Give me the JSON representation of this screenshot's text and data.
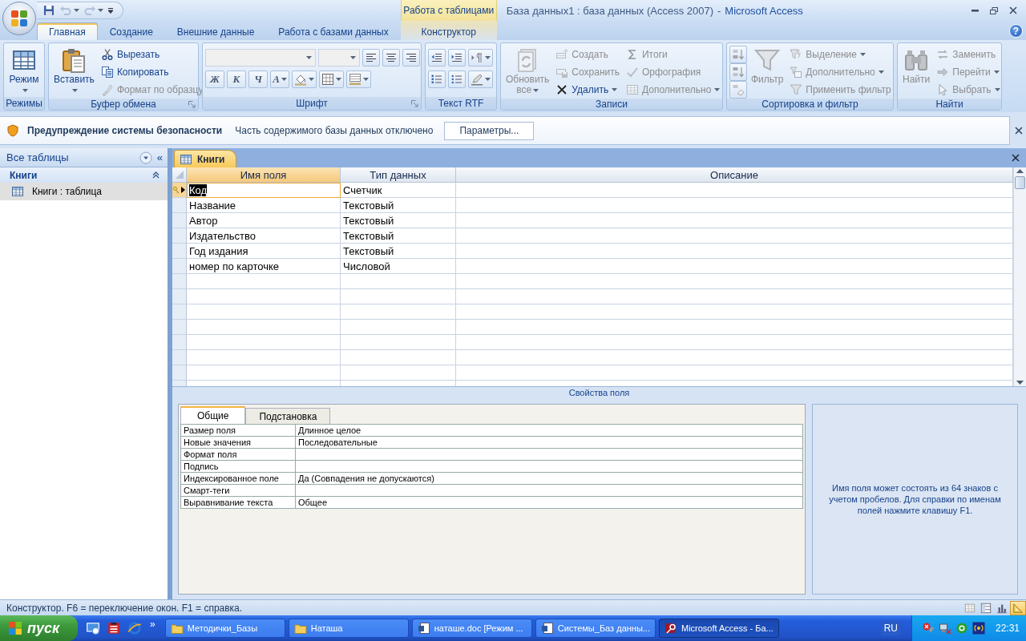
{
  "title_bar": {
    "context_group": "Работа с таблицами",
    "document_title": "База данных1 : база данных (Access 2007)",
    "separator": "-",
    "app_name": "Microsoft Access"
  },
  "quick_access": [
    {
      "kind": "button",
      "disabled": false
    },
    {
      "kind": "button",
      "disabled": true,
      "dropdown": true
    },
    {
      "kind": "button",
      "disabled": true,
      "dropdown": true
    },
    {
      "kind": "menu"
    }
  ],
  "ribbon_tabs": [
    {
      "label": "Главная",
      "selected": true,
      "contextual": false
    },
    {
      "label": "Создание",
      "selected": false,
      "contextual": false
    },
    {
      "label": "Внешние данные",
      "selected": false,
      "contextual": false
    },
    {
      "label": "Работа с базами данных",
      "selected": false,
      "contextual": false
    },
    {
      "label": "Конструктор",
      "selected": false,
      "contextual": true
    }
  ],
  "help_button": "?",
  "ribbon_groups": [
    {
      "title": "Режимы",
      "launcher": false,
      "items": [
        {
          "kind": "large",
          "label": "Режим",
          "dropdown": true,
          "disabled": false
        }
      ]
    },
    {
      "title": "Буфер обмена",
      "launcher": true,
      "items": [
        {
          "kind": "large",
          "label": "Вставить",
          "dropdown": true,
          "disabled": false
        },
        {
          "kind": "small",
          "label": "Вырезать",
          "disabled": false
        },
        {
          "kind": "small",
          "label": "Копировать",
          "disabled": false
        },
        {
          "kind": "small",
          "label": "Формат по образцу",
          "disabled": true
        }
      ]
    },
    {
      "title": "Шрифт",
      "launcher": true,
      "rows": [
        [
          {
            "kind": "combo",
            "disabled": true
          },
          {
            "kind": "combo",
            "disabled": true
          },
          {
            "kind": "icon"
          },
          {
            "kind": "icon"
          },
          {
            "kind": "icon"
          }
        ],
        [
          {
            "kind": "glyph",
            "label": "Ж"
          },
          {
            "kind": "glyph",
            "label": "К"
          },
          {
            "kind": "glyph",
            "label": "Ч"
          },
          {
            "kind": "glyph",
            "label": "А",
            "dropdown": true
          },
          {
            "kind": "icon",
            "dropdown": true
          },
          {
            "kind": "icon",
            "dropdown": true
          },
          {
            "kind": "icon",
            "dropdown": true
          }
        ]
      ]
    },
    {
      "title": "Текст RTF",
      "launcher": false,
      "rows": [
        [
          {
            "kind": "icon"
          },
          {
            "kind": "icon"
          },
          {
            "kind": "icon",
            "dropdown": true
          }
        ],
        [
          {
            "kind": "icon"
          },
          {
            "kind": "icon"
          },
          {
            "kind": "icon",
            "dropdown": true
          }
        ]
      ]
    },
    {
      "title": "Записи",
      "launcher": false,
      "items": [
        {
          "kind": "large",
          "label": "Обновить все",
          "dropdown": true,
          "disabled": true
        },
        {
          "kind": "small",
          "label": "Создать",
          "disabled": true
        },
        {
          "kind": "small",
          "label": "Сохранить",
          "disabled": true
        },
        {
          "kind": "small",
          "label": "Удалить",
          "dropdown": true,
          "disabled": false
        },
        {
          "kind": "small",
          "label": "Итоги",
          "disabled": true
        },
        {
          "kind": "small",
          "label": "Орфография",
          "disabled": true
        },
        {
          "kind": "small",
          "label": "Дополнительно",
          "dropdown": true,
          "disabled": true
        }
      ]
    },
    {
      "title": "Сортировка и фильтр",
      "launcher": false,
      "items": [
        {
          "kind": "icon",
          "disabled": true
        },
        {
          "kind": "icon",
          "disabled": true
        },
        {
          "kind": "icon",
          "disabled": true
        },
        {
          "kind": "large",
          "label": "Фильтр",
          "disabled": true
        },
        {
          "kind": "small",
          "label": "Выделение",
          "dropdown": true,
          "disabled": true
        },
        {
          "kind": "small",
          "label": "Дополнительно",
          "dropdown": true,
          "disabled": true
        },
        {
          "kind": "small",
          "label": "Применить фильтр",
          "disabled": true
        }
      ]
    },
    {
      "title": "Найти",
      "launcher": false,
      "items": [
        {
          "kind": "large",
          "label": "Найти",
          "disabled": true
        },
        {
          "kind": "small",
          "label": "Заменить",
          "disabled": true
        },
        {
          "kind": "small",
          "label": "Перейти",
          "dropdown": true,
          "disabled": true
        },
        {
          "kind": "small",
          "label": "Выбрать",
          "dropdown": true,
          "disabled": true
        }
      ]
    }
  ],
  "security_bar": {
    "title": "Предупреждение системы безопасности",
    "message": "Часть содержимого базы данных отключено",
    "button": "Параметры..."
  },
  "navigation_pane": {
    "title": "Все таблицы",
    "collapse": "«",
    "groups": [
      {
        "title": "Книги",
        "expanded": true,
        "items": [
          {
            "label": "Книги : таблица",
            "selected": true
          }
        ]
      }
    ]
  },
  "document": {
    "tab": "Книги",
    "columns": [
      "Имя поля",
      "Тип данных",
      "Описание"
    ],
    "rows": [
      {
        "field_name": "Код",
        "data_type": "Счетчик",
        "primary_key": true,
        "selected": true
      },
      {
        "field_name": "Название",
        "data_type": "Текстовый",
        "primary_key": false,
        "selected": false
      },
      {
        "field_name": "Автор",
        "data_type": "Текстовый",
        "primary_key": false,
        "selected": false
      },
      {
        "field_name": "Издательство",
        "data_type": "Текстовый",
        "primary_key": false,
        "selected": false
      },
      {
        "field_name": "Год издания",
        "data_type": "Текстовый",
        "primary_key": false,
        "selected": false
      },
      {
        "field_name": "номер по карточке",
        "data_type": "Числовой",
        "primary_key": false,
        "selected": false
      }
    ],
    "properties_title": "Свойства поля",
    "property_tabs": [
      {
        "label": "Общие",
        "selected": true
      },
      {
        "label": "Подстановка",
        "selected": false
      }
    ],
    "properties": [
      {
        "name": "Размер поля",
        "value": "Длинное целое"
      },
      {
        "name": "Новые значения",
        "value": "Последовательные"
      },
      {
        "name": "Формат поля"
      },
      {
        "name": "Подпись"
      },
      {
        "name": "Индексированное поле",
        "value": "Да (Совпадения не допускаются)"
      },
      {
        "name": "Смарт-теги"
      },
      {
        "name": "Выравнивание текста",
        "value": "Общее"
      }
    ],
    "help_text": "Имя поля может состоять из 64 знаков с учетом пробелов. Для справки по именам полей нажмите клавишу F1."
  },
  "status_bar": {
    "text": "Конструктор. F6 = переключение окон. F1 = справка.",
    "view_buttons": [
      {
        "selected": false
      },
      {
        "selected": false
      },
      {
        "selected": false
      },
      {
        "selected": true
      }
    ]
  },
  "taskbar": {
    "start": "пуск",
    "more": "»",
    "tasks": [
      {
        "label": "Методички_Базы",
        "selected": false
      },
      {
        "label": "Наташа",
        "selected": false
      },
      {
        "label": "наташе.doc [Режим ...",
        "selected": false
      },
      {
        "label": "Системы_Баз данны...",
        "selected": false
      },
      {
        "label": "Microsoft Access - Ба...",
        "selected": true
      }
    ],
    "language": "RU",
    "clock": "22:31"
  }
}
